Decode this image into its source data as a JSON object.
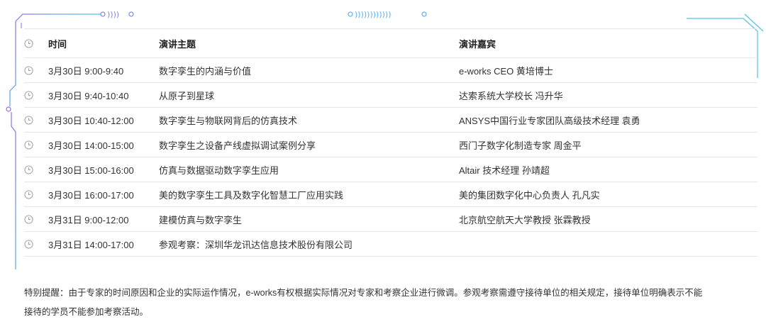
{
  "table": {
    "headers": {
      "time": "时间",
      "topic": "演讲主题",
      "speaker": "演讲嘉宾"
    },
    "rows": [
      {
        "time": "3月30日 9:00-9:40",
        "topic": "数字孪生的内涵与价值",
        "speaker": "e-works CEO  黄培博士"
      },
      {
        "time": "3月30日 9:40-10:40",
        "topic": "从原子到星球",
        "speaker": "达索系统大学校长  冯升华"
      },
      {
        "time": "3月30日 10:40-12:00",
        "topic": "数字孪生与物联网背后的仿真技术",
        "speaker": "ANSYS中国行业专家团队高级技术经理 袁勇"
      },
      {
        "time": "3月30日 14:00-15:00",
        "topic": "数字孪生之设备产线虚拟调试案例分享",
        "speaker": "西门子数字化制造专家 周金平"
      },
      {
        "time": "3月30日 15:00-16:00",
        "topic": "仿真与数据驱动数字孪生应用",
        "speaker": "Altair 技术经理  孙靖超"
      },
      {
        "time": "3月30日 16:00-17:00",
        "topic": "美的数字孪生工具及数字化智慧工厂应用实践",
        "speaker": "美的集团数字化中心负责人  孔凡实"
      },
      {
        "time": "3月31日 9:00-12:00",
        "topic": "建模仿真与数字孪生",
        "speaker": "北京航空航天大学教授 张霖教授"
      },
      {
        "time": "3月31日 14:00-17:00",
        "topic": "参观考察：深圳华龙讯达信息技术股份有限公司",
        "speaker": ""
      }
    ]
  },
  "note": {
    "line1": "特别提醒：由于专家的时间原因和企业的实际运作情况，e-works有权根据实际情况对专家和考察企业进行微调。参观考察需遵守接待单位的相关规定，接待单位明确表示不能",
    "line2": "接待的学员不能参加考察活动。"
  },
  "colors": {
    "frame_line": "#5b8de6",
    "frame_accent": "#6fd3e8",
    "clock": "#9a9a9a",
    "divider": "#e6e6e6"
  }
}
